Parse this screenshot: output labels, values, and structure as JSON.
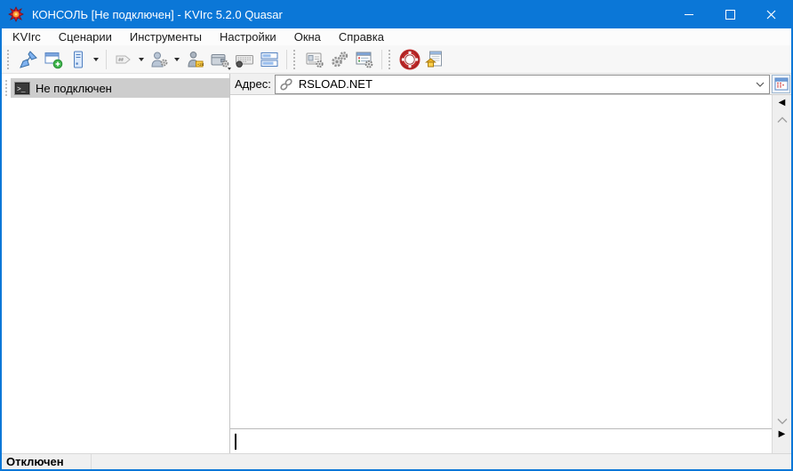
{
  "window": {
    "title": "КОНСОЛЬ [Не подключен] - KVIrc 5.2.0 Quasar",
    "app_icon": "kvirc-flower-icon"
  },
  "titlebar_controls": [
    "minimize",
    "maximize",
    "close"
  ],
  "menu_bar": {
    "items": [
      {
        "label": "KVIrc"
      },
      {
        "label": "Сценарии"
      },
      {
        "label": "Инструменты"
      },
      {
        "label": "Настройки"
      },
      {
        "label": "Окна"
      },
      {
        "label": "Справка"
      }
    ]
  },
  "toolbar": {
    "buttons": [
      {
        "name": "connect",
        "icon": "plug-connect-icon",
        "dropdown": false,
        "disabled": false
      },
      {
        "name": "new-console",
        "icon": "window-plus-icon",
        "dropdown": false,
        "disabled": false
      },
      {
        "name": "servers",
        "icon": "server-icon",
        "dropdown": true,
        "disabled": false
      },
      {
        "name": "join-channel",
        "icon": "channel-hash-icon",
        "dropdown": true,
        "disabled": true
      },
      {
        "name": "user-options",
        "icon": "user-wrench-icon",
        "dropdown": true,
        "disabled": false
      },
      {
        "name": "away",
        "icon": "user-away-badge-icon",
        "dropdown": false,
        "disabled": false
      },
      {
        "name": "identity-wallet",
        "icon": "wallet-gear-icon",
        "dropdown": true,
        "disabled": false
      },
      {
        "name": "keyboard",
        "icon": "keyboard-icon",
        "dropdown": false,
        "disabled": false
      },
      {
        "name": "input-style",
        "icon": "text-fields-icon",
        "dropdown": false,
        "disabled": false
      },
      {
        "name": "identity",
        "icon": "id-card-gear-icon",
        "dropdown": false,
        "disabled": false
      },
      {
        "name": "options",
        "icon": "gears-icon",
        "dropdown": false,
        "disabled": false
      },
      {
        "name": "theme-options",
        "icon": "window-gear-icon",
        "dropdown": false,
        "disabled": false
      },
      {
        "name": "help",
        "icon": "lifebuoy-icon",
        "dropdown": false,
        "disabled": false
      },
      {
        "name": "homepage",
        "icon": "home-document-icon",
        "dropdown": false,
        "disabled": false
      }
    ]
  },
  "address_bar": {
    "label": "Адрес:",
    "value": "RSLOAD.NET",
    "field_icon": "chain-link-icon",
    "toggle_icon": "window-list-icon"
  },
  "window_list": {
    "items": [
      {
        "label": "Не подключен",
        "icon": "console-terminal-icon",
        "selected": true
      }
    ]
  },
  "console": {
    "text": ""
  },
  "input_line": {
    "value": ""
  },
  "status_bar": {
    "text": "Отключен"
  },
  "colors": {
    "titlebar": "#0b77d7",
    "accent": "#0b77d7",
    "selected_item": "#cdcdcd",
    "toolbar_bg": "#f7f7f7",
    "address_row_bg": "#f0f0f0",
    "gutter_bg": "#efefef",
    "help_red": "#c22a2a",
    "new_green": "#3cb54a"
  }
}
